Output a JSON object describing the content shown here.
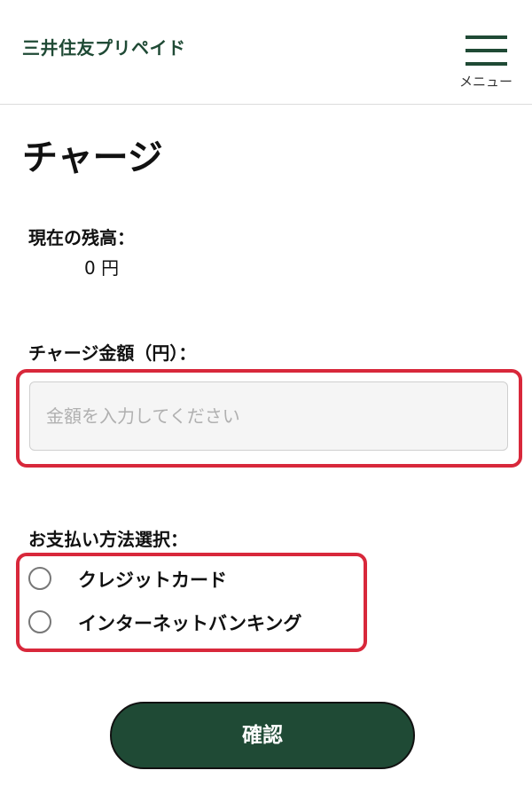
{
  "header": {
    "brand": "三井住友プリペイド",
    "menu_label": "メニュー"
  },
  "page": {
    "title": "チャージ"
  },
  "balance": {
    "label": "現在の残高：",
    "value": "0 円"
  },
  "charge_amount": {
    "label": "チャージ金額（円）：",
    "placeholder": "金額を入力してください",
    "value": ""
  },
  "payment": {
    "label": "お支払い方法選択：",
    "options": [
      {
        "label": "クレジットカード",
        "selected": false
      },
      {
        "label": "インターネットバンキング",
        "selected": false
      }
    ]
  },
  "confirm_button": {
    "label": "確認"
  },
  "colors": {
    "brand": "#1f4a35",
    "highlight": "#d8283b",
    "input_bg": "#f5f5f5"
  },
  "icons": {
    "menu": "hamburger-menu-icon",
    "radio": "radio-unchecked-icon"
  }
}
